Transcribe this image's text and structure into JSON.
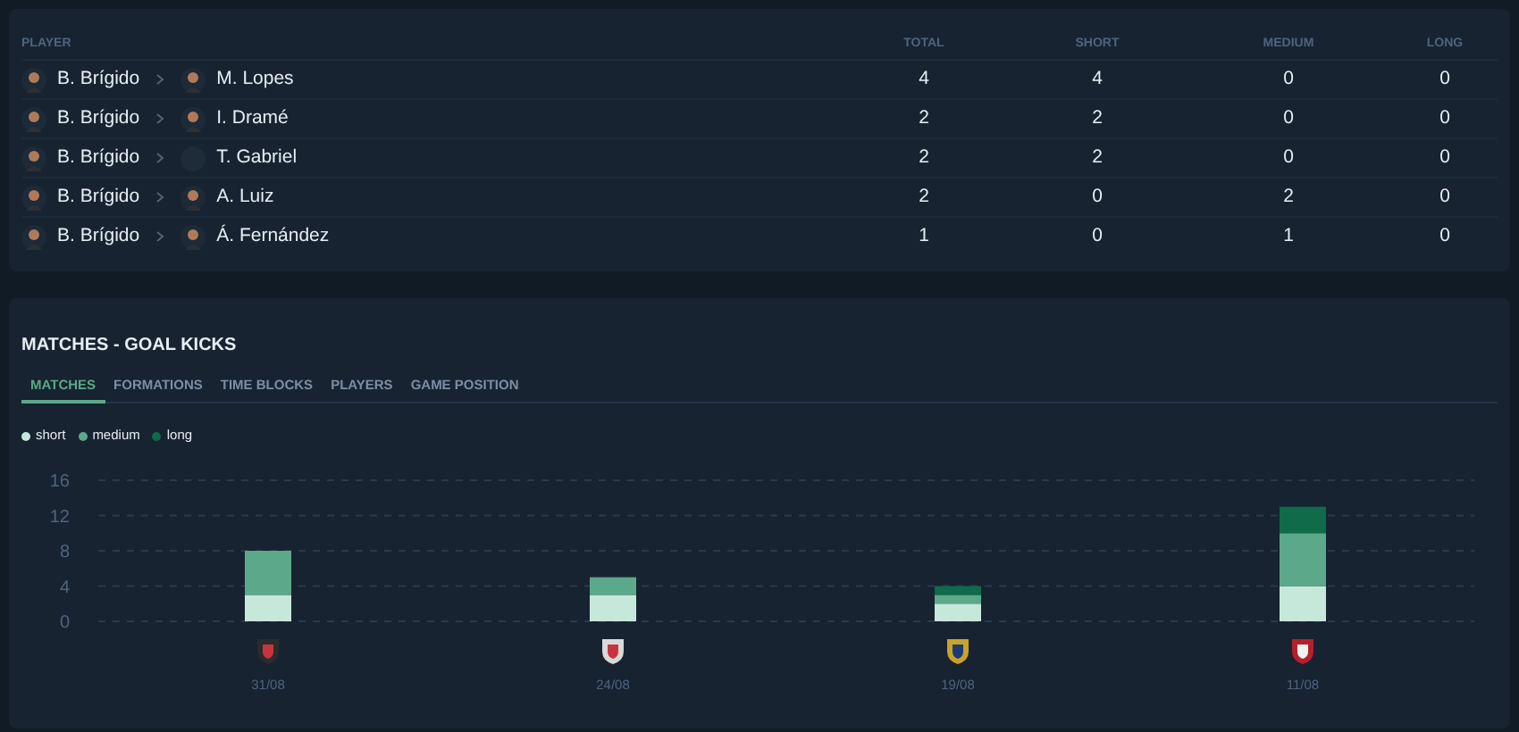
{
  "table": {
    "columns": [
      "PLAYER",
      "TOTAL",
      "SHORT",
      "MEDIUM",
      "LONG"
    ],
    "rows": [
      {
        "from": "B. Brígido",
        "to": "M. Lopes",
        "to_has_photo": true,
        "values": [
          "4",
          "4",
          "0",
          "0"
        ]
      },
      {
        "from": "B. Brígido",
        "to": "I. Dramé",
        "to_has_photo": true,
        "values": [
          "2",
          "2",
          "0",
          "0"
        ]
      },
      {
        "from": "B. Brígido",
        "to": "T. Gabriel",
        "to_has_photo": false,
        "values": [
          "2",
          "2",
          "0",
          "0"
        ]
      },
      {
        "from": "B. Brígido",
        "to": "A. Luiz",
        "to_has_photo": true,
        "values": [
          "2",
          "0",
          "2",
          "0"
        ]
      },
      {
        "from": "B. Brígido",
        "to": "Á. Fernández",
        "to_has_photo": true,
        "values": [
          "1",
          "0",
          "1",
          "0"
        ]
      }
    ]
  },
  "section": {
    "title": "MATCHES - GOAL KICKS",
    "tabs": [
      {
        "label": "MATCHES",
        "selected": true
      },
      {
        "label": "FORMATIONS",
        "selected": false
      },
      {
        "label": "TIME BLOCKS",
        "selected": false
      },
      {
        "label": "PLAYERS",
        "selected": false
      },
      {
        "label": "GAME POSITION",
        "selected": false
      }
    ],
    "chart_data": {
      "type": "bar",
      "stacked": true,
      "grid": true,
      "categories": [
        "31/08",
        "24/08",
        "19/08",
        "11/08"
      ],
      "series": [
        {
          "name": "short",
          "color": "#c6e8db",
          "values": [
            3,
            3,
            2,
            4
          ]
        },
        {
          "name": "medium",
          "color": "#5ba98a",
          "values": [
            5,
            2,
            1,
            6
          ]
        },
        {
          "name": "long",
          "color": "#0f6b49",
          "values": [
            0,
            0,
            1,
            3
          ]
        }
      ],
      "ylim": [
        0,
        16
      ],
      "yticks": [
        0,
        4,
        8,
        12,
        16
      ]
    }
  }
}
